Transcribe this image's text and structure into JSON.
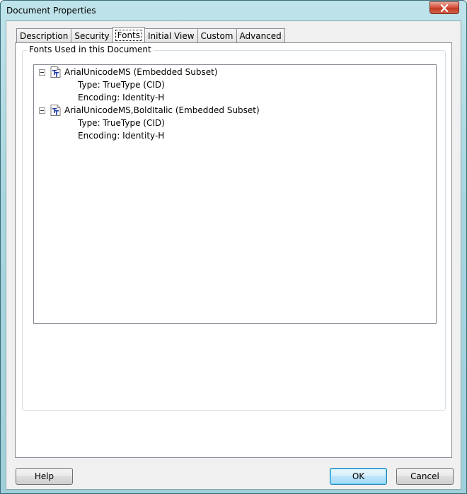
{
  "window": {
    "title": "Document Properties"
  },
  "tabs": [
    {
      "label": "Description"
    },
    {
      "label": "Security"
    },
    {
      "label": "Fonts",
      "active": true
    },
    {
      "label": "Initial View"
    },
    {
      "label": "Custom"
    },
    {
      "label": "Advanced"
    }
  ],
  "fonts_panel": {
    "group_label": "Fonts Used in this Document",
    "fonts": [
      {
        "name": "ArialUnicodeMS (Embedded Subset)",
        "type": "Type: TrueType (CID)",
        "encoding": "Encoding: Identity-H",
        "icon": "truetype-font-icon"
      },
      {
        "name": "ArialUnicodeMS,BoldItalic (Embedded Subset)",
        "type": "Type: TrueType (CID)",
        "encoding": "Encoding: Identity-H",
        "icon": "truetype-font-icon"
      }
    ]
  },
  "buttons": {
    "help": "Help",
    "ok": "OK",
    "cancel": "Cancel"
  },
  "colors": {
    "titlebar": "#a8d6df",
    "close_button": "#c13a22",
    "default_button_border": "#3c7fb1"
  }
}
